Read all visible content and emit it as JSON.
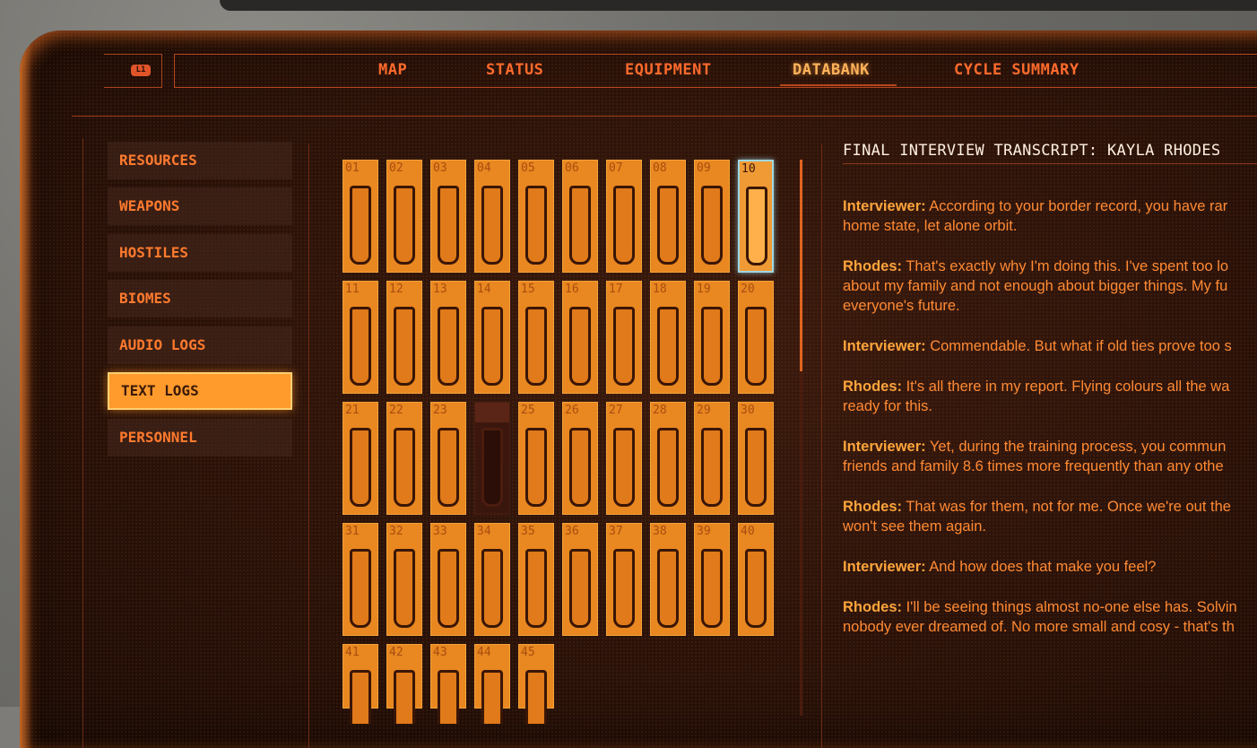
{
  "header": {
    "l1_badge": "L1",
    "tabs": [
      {
        "label": "MAP"
      },
      {
        "label": "STATUS"
      },
      {
        "label": "EQUIPMENT"
      },
      {
        "label": "DATABANK"
      },
      {
        "label": "CYCLE SUMMARY"
      }
    ],
    "active_tab": "DATABANK"
  },
  "sidebar": {
    "items": [
      {
        "label": "RESOURCES"
      },
      {
        "label": "WEAPONS"
      },
      {
        "label": "HOSTILES"
      },
      {
        "label": "BIOMES"
      },
      {
        "label": "AUDIO LOGS"
      },
      {
        "label": "TEXT LOGS"
      },
      {
        "label": "PERSONNEL"
      }
    ],
    "active_item": "TEXT LOGS"
  },
  "grid": {
    "cells": [
      "01",
      "02",
      "03",
      "04",
      "05",
      "06",
      "07",
      "08",
      "09",
      "10",
      "11",
      "12",
      "13",
      "14",
      "15",
      "16",
      "17",
      "18",
      "19",
      "20",
      "21",
      "22",
      "23",
      "",
      "25",
      "26",
      "27",
      "28",
      "29",
      "30",
      "31",
      "32",
      "33",
      "34",
      "35",
      "36",
      "37",
      "38",
      "39",
      "40",
      "41",
      "42",
      "43",
      "44",
      "45"
    ],
    "selected": "10",
    "empty_slot": 24
  },
  "transcript": {
    "title": "FINAL INTERVIEW TRANSCRIPT: KAYLA RHODES",
    "entries": [
      {
        "speaker": "Interviewer:",
        "lines": [
          " According to your border record, you have rar",
          "home state, let alone orbit."
        ]
      },
      {
        "speaker": "Rhodes:",
        "lines": [
          " That's exactly why I'm doing this. I've spent too lo",
          "about my family and not enough about bigger things. My fu",
          "everyone's future."
        ]
      },
      {
        "speaker": "Interviewer:",
        "lines": [
          " Commendable. But what if old ties prove too s"
        ]
      },
      {
        "speaker": "Rhodes:",
        "lines": [
          " It's all there in my report. Flying colours all the wa",
          "ready for this."
        ]
      },
      {
        "speaker": "Interviewer:",
        "lines": [
          " Yet, during the training process, you commun",
          "friends and family 8.6 times more frequently than any othe"
        ]
      },
      {
        "speaker": "Rhodes:",
        "lines": [
          " That was for them, not for me. Once we're out the",
          "won't see them again."
        ]
      },
      {
        "speaker": "Interviewer:",
        "lines": [
          " And how does that make you feel?"
        ]
      },
      {
        "speaker": "Rhodes:",
        "lines": [
          " I'll be seeing things almost no-one else has. Solvin",
          "nobody ever dreamed of. No more small and cosy - that's th"
        ]
      }
    ]
  },
  "colors": {
    "accent": "#ff6a2c",
    "active_tab": "#ffb35a",
    "cell_fill": "#e98720",
    "selected_outline": "#9fd6e2",
    "background": "#2a1209"
  }
}
